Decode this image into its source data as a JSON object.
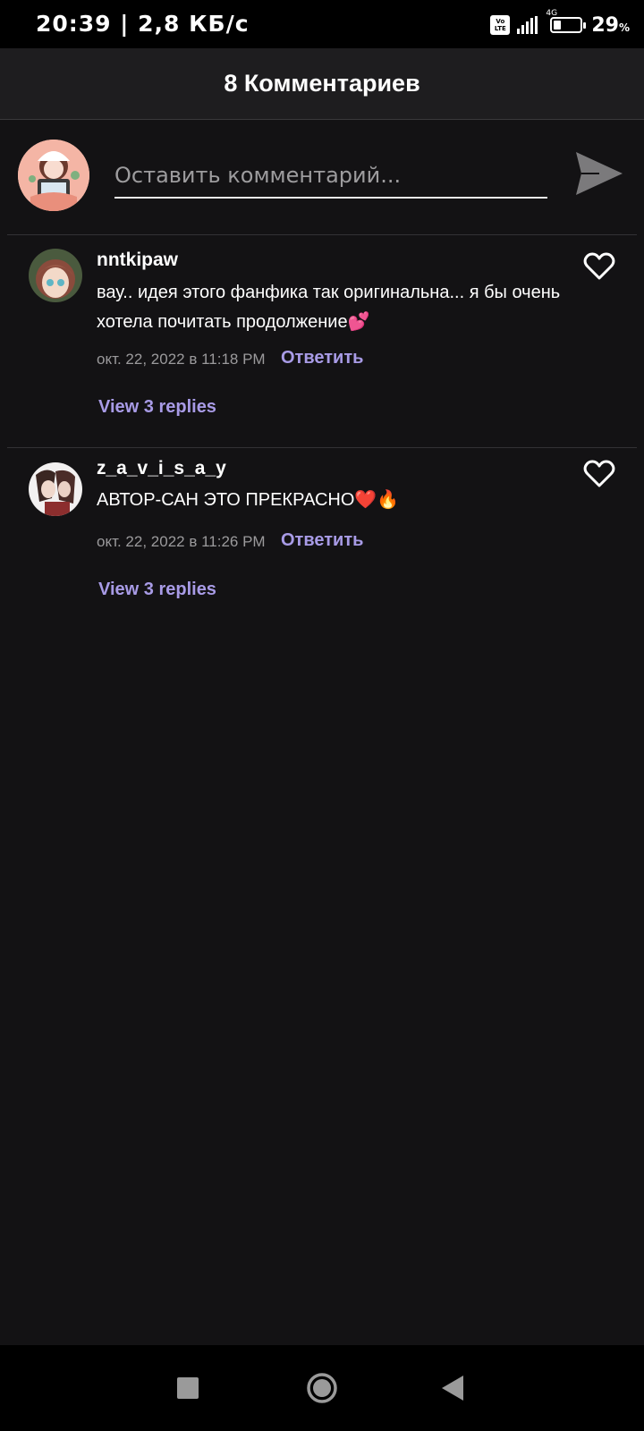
{
  "status_bar": {
    "time_speed": "20:39 | 2,8 КБ/с",
    "volte_top": "Vo",
    "volte_bottom": "LTE",
    "network": "4G",
    "battery_level": 0.29,
    "battery_percent": "29",
    "battery_unit": "%"
  },
  "header": {
    "title": "8 Комментариев"
  },
  "composer": {
    "placeholder": "Оставить комментарий...",
    "send_icon": "send-icon"
  },
  "comments": [
    {
      "username": "nntkipaw",
      "text": "вау.. идея этого фанфика так оригинальна... я бы очень хотела почитать продолжение",
      "emoji": "💕",
      "timestamp": "окт. 22, 2022 в 11:18 PM",
      "reply_label": "Ответить",
      "view_replies": "View 3 replies"
    },
    {
      "username": "z_a_v_i_s_a_y",
      "text": "АВТОР-САН ЭТО ПРЕКРАСНО",
      "emoji": "❤️🔥",
      "timestamp": "окт. 22, 2022 в 11:26 PM",
      "reply_label": "Ответить",
      "view_replies": "View 3 replies"
    }
  ],
  "colors": {
    "background": "#131214",
    "header": "#1e1d1f",
    "accent": "#a89be6",
    "muted": "#9b9a9c"
  }
}
